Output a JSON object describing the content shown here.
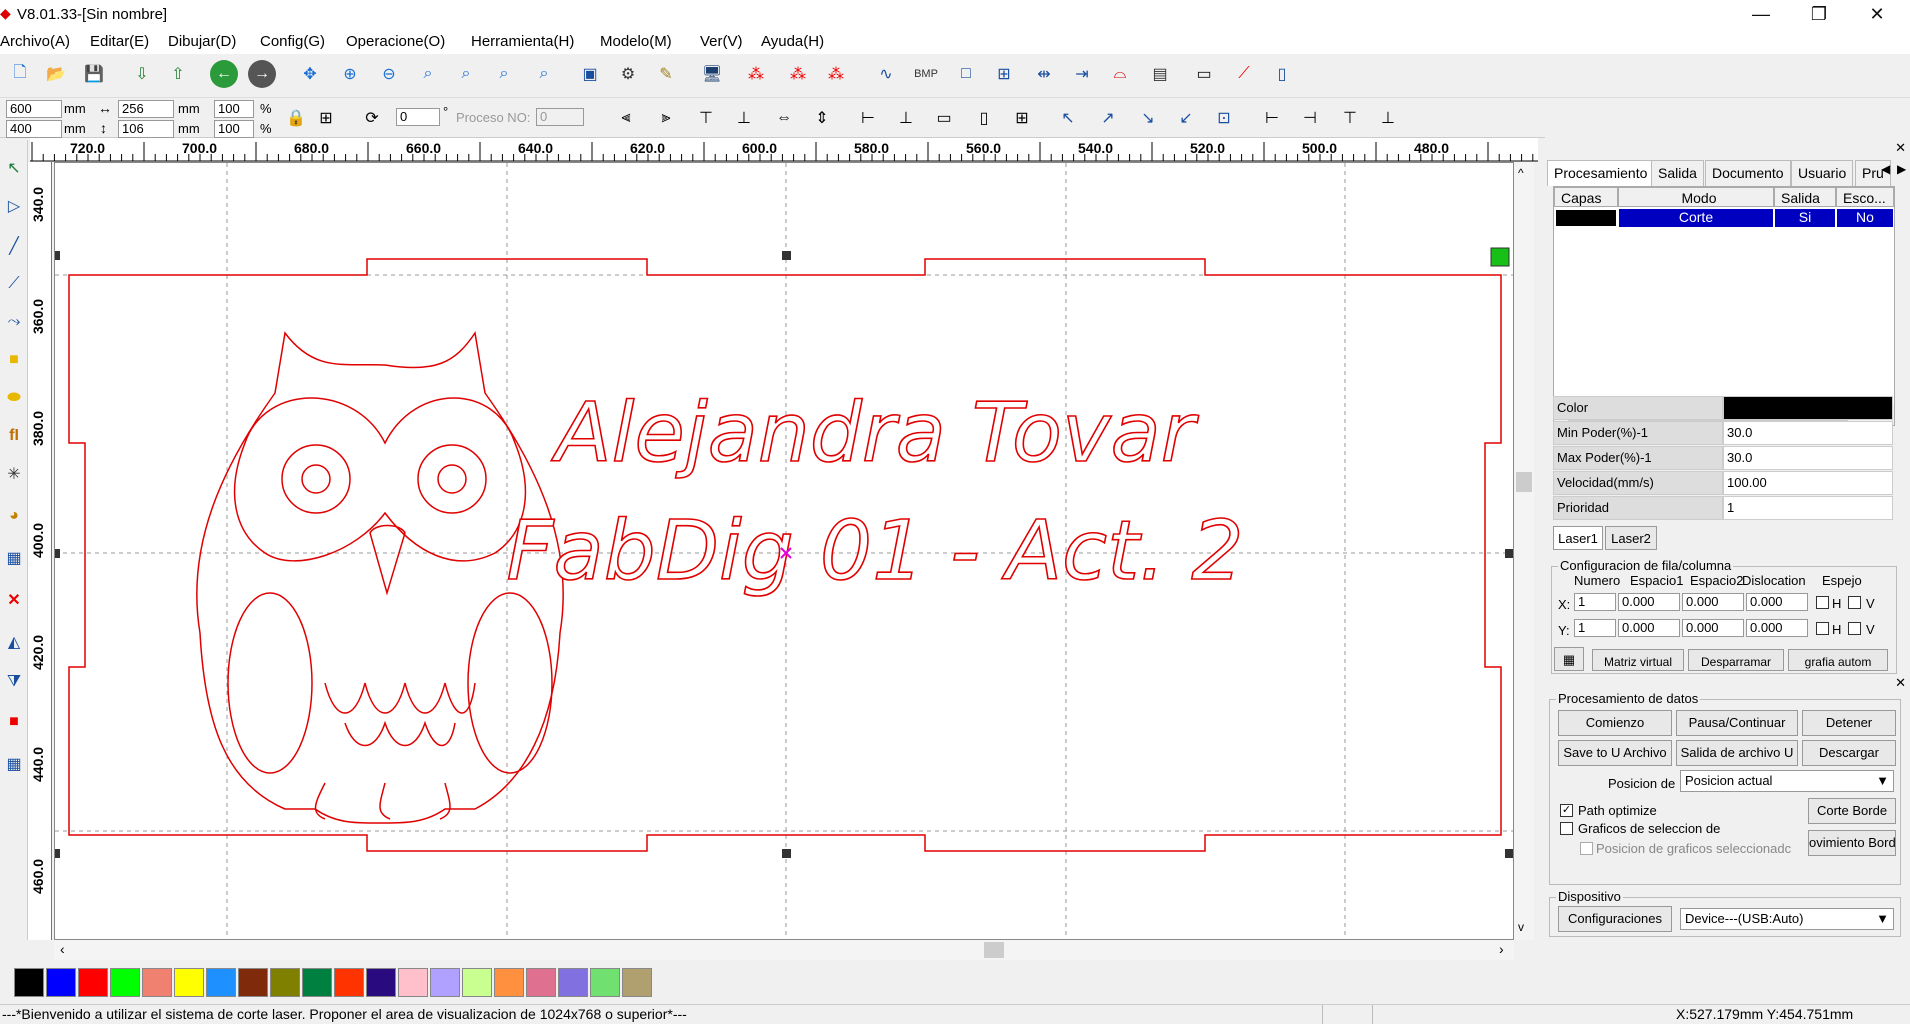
{
  "window": {
    "title": "V8.01.33-[Sin nombre]"
  },
  "menu": [
    "Archivo(A)",
    "Editar(E)",
    "Dibujar(D)",
    "Config(G)",
    "Operacione(O)",
    "Herramienta(H)",
    "Modelo(M)",
    "Ver(V)",
    "Ayuda(H)"
  ],
  "toolbar2": {
    "pos_x": "600",
    "pos_y": "400",
    "unit": "mm",
    "size_w": "256",
    "size_h": "106",
    "scale_w": "100",
    "scale_h": "100",
    "pct": "%",
    "rotate_value": "0",
    "degree": "°",
    "proceso_label": "Proceso NO:",
    "proceso_value": "0"
  },
  "ruler_top": [
    "720.0",
    "700.0",
    "680.0",
    "660.0",
    "640.0",
    "620.0",
    "600.0",
    "580.0",
    "560.0",
    "540.0",
    "520.0",
    "500.0",
    "480.0"
  ],
  "ruler_left": [
    "340.0",
    "360.0",
    "380.0",
    "400.0",
    "420.0",
    "440.0",
    "460.0"
  ],
  "canvas": {
    "text_line1": "Alejandra Tovar",
    "text_line2": "FabDig 01 - Act. 2",
    "stroke_color": "#e00000"
  },
  "palette": [
    "#000000",
    "#0000ff",
    "#ff0000",
    "#00ff00",
    "#f08070",
    "#ffff00",
    "#1e90ff",
    "#7f2a0a",
    "#808000",
    "#008040",
    "#ff3300",
    "#2a0a7f",
    "#ffc0cb",
    "#b0a0ff",
    "#c8ff90",
    "#ff9040",
    "#e07090",
    "#8070e0",
    "#70e070",
    "#b0a070"
  ],
  "status": {
    "message": "---*Bienvenido a utilizar el sistema de corte laser. Proponer el area de visualizacion de 1024x768 o superior*---",
    "coords": "X:527.179mm Y:454.751mm"
  },
  "panel": {
    "tabs": [
      "Procesamiento",
      "Salida",
      "Documento",
      "Usuario",
      "Pru"
    ],
    "layer_headers": [
      "Capas",
      "Modo",
      "Salida",
      "Esco..."
    ],
    "layer_row": {
      "mode": "Corte",
      "output": "Si",
      "hide": "No",
      "color": "#000000"
    },
    "props": [
      {
        "name": "Color",
        "value": ""
      },
      {
        "name": "Min Poder(%)-1",
        "value": "30.0"
      },
      {
        "name": "Max Poder(%)-1",
        "value": "30.0"
      },
      {
        "name": "Velocidad(mm/s)",
        "value": "100.00"
      },
      {
        "name": "Prioridad",
        "value": "1"
      }
    ],
    "laser_tabs": [
      "Laser1",
      "Laser2"
    ],
    "array": {
      "title": "Configuracion de fila/columna",
      "headers": [
        "Numero",
        "Espacio1",
        "Espacio2",
        "Dislocation",
        "Espejo"
      ],
      "x": {
        "label": "X:",
        "num": "1",
        "s1": "0.000",
        "s2": "0.000",
        "d": "0.000",
        "h": "H",
        "v": "V"
      },
      "y": {
        "label": "Y:",
        "num": "1",
        "s1": "0.000",
        "s2": "0.000",
        "d": "0.000",
        "h": "H",
        "v": "V"
      }
    },
    "array_buttons": [
      "Matriz virtual",
      "Desparramar",
      "grafia autom"
    ]
  },
  "processing": {
    "title": "Procesamiento de datos",
    "buttons": [
      "Comienzo",
      "Pausa/Continuar",
      "Detener",
      "Save to U Archivo",
      "Salida de archivo U",
      "Descargar"
    ],
    "position_label": "Posicion de",
    "position_value": "Posicion actual",
    "path_optimize": "Path optimize",
    "graficos": "Graficos de seleccion de",
    "posicion_graficos": "Posicion de graficos seleccionadc",
    "corte_borde": "Corte Borde",
    "movimiento": "ovimiento Bord",
    "device_title": "Dispositivo",
    "config_button": "Configuraciones",
    "device_value": "Device---(USB:Auto)"
  }
}
